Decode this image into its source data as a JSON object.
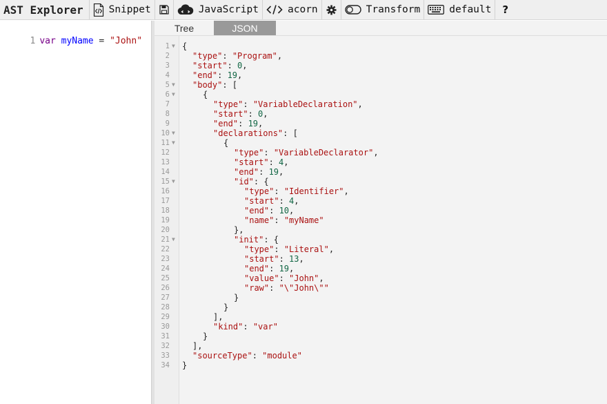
{
  "app": {
    "title": "AST Explorer"
  },
  "toolbar": {
    "snippet_label": "Snippet",
    "language_label": "JavaScript",
    "parser_label": "acorn",
    "transform_label": "Transform",
    "keymap_label": "default",
    "help_label": "?"
  },
  "editor": {
    "line_number": "1",
    "tokens": {
      "keyword": "var",
      "identifier": "myName",
      "operator": "=",
      "string": "\"John\""
    }
  },
  "output": {
    "tabs": [
      {
        "label": "Tree",
        "active": false
      },
      {
        "label": "JSON",
        "active": true
      }
    ],
    "json_lines": [
      {
        "n": "1",
        "fold": true,
        "indent": 0,
        "parts": [
          [
            "p",
            "{"
          ]
        ]
      },
      {
        "n": "2",
        "fold": false,
        "indent": 1,
        "parts": [
          [
            "k",
            "\"type\""
          ],
          [
            "p",
            ": "
          ],
          [
            "s",
            "\"Program\""
          ],
          [
            "p",
            ","
          ]
        ]
      },
      {
        "n": "3",
        "fold": false,
        "indent": 1,
        "parts": [
          [
            "k",
            "\"start\""
          ],
          [
            "p",
            ": "
          ],
          [
            "n",
            "0"
          ],
          [
            "p",
            ","
          ]
        ]
      },
      {
        "n": "4",
        "fold": false,
        "indent": 1,
        "parts": [
          [
            "k",
            "\"end\""
          ],
          [
            "p",
            ": "
          ],
          [
            "n",
            "19"
          ],
          [
            "p",
            ","
          ]
        ]
      },
      {
        "n": "5",
        "fold": true,
        "indent": 1,
        "parts": [
          [
            "k",
            "\"body\""
          ],
          [
            "p",
            ": ["
          ]
        ]
      },
      {
        "n": "6",
        "fold": true,
        "indent": 2,
        "parts": [
          [
            "p",
            "{"
          ]
        ]
      },
      {
        "n": "7",
        "fold": false,
        "indent": 3,
        "parts": [
          [
            "k",
            "\"type\""
          ],
          [
            "p",
            ": "
          ],
          [
            "s",
            "\"VariableDeclaration\""
          ],
          [
            "p",
            ","
          ]
        ]
      },
      {
        "n": "8",
        "fold": false,
        "indent": 3,
        "parts": [
          [
            "k",
            "\"start\""
          ],
          [
            "p",
            ": "
          ],
          [
            "n",
            "0"
          ],
          [
            "p",
            ","
          ]
        ]
      },
      {
        "n": "9",
        "fold": false,
        "indent": 3,
        "parts": [
          [
            "k",
            "\"end\""
          ],
          [
            "p",
            ": "
          ],
          [
            "n",
            "19"
          ],
          [
            "p",
            ","
          ]
        ]
      },
      {
        "n": "10",
        "fold": true,
        "indent": 3,
        "parts": [
          [
            "k",
            "\"declarations\""
          ],
          [
            "p",
            ": ["
          ]
        ]
      },
      {
        "n": "11",
        "fold": true,
        "indent": 4,
        "parts": [
          [
            "p",
            "{"
          ]
        ]
      },
      {
        "n": "12",
        "fold": false,
        "indent": 5,
        "parts": [
          [
            "k",
            "\"type\""
          ],
          [
            "p",
            ": "
          ],
          [
            "s",
            "\"VariableDeclarator\""
          ],
          [
            "p",
            ","
          ]
        ]
      },
      {
        "n": "13",
        "fold": false,
        "indent": 5,
        "parts": [
          [
            "k",
            "\"start\""
          ],
          [
            "p",
            ": "
          ],
          [
            "n",
            "4"
          ],
          [
            "p",
            ","
          ]
        ]
      },
      {
        "n": "14",
        "fold": false,
        "indent": 5,
        "parts": [
          [
            "k",
            "\"end\""
          ],
          [
            "p",
            ": "
          ],
          [
            "n",
            "19"
          ],
          [
            "p",
            ","
          ]
        ]
      },
      {
        "n": "15",
        "fold": true,
        "indent": 5,
        "parts": [
          [
            "k",
            "\"id\""
          ],
          [
            "p",
            ": {"
          ]
        ]
      },
      {
        "n": "16",
        "fold": false,
        "indent": 6,
        "parts": [
          [
            "k",
            "\"type\""
          ],
          [
            "p",
            ": "
          ],
          [
            "s",
            "\"Identifier\""
          ],
          [
            "p",
            ","
          ]
        ]
      },
      {
        "n": "17",
        "fold": false,
        "indent": 6,
        "parts": [
          [
            "k",
            "\"start\""
          ],
          [
            "p",
            ": "
          ],
          [
            "n",
            "4"
          ],
          [
            "p",
            ","
          ]
        ]
      },
      {
        "n": "18",
        "fold": false,
        "indent": 6,
        "parts": [
          [
            "k",
            "\"end\""
          ],
          [
            "p",
            ": "
          ],
          [
            "n",
            "10"
          ],
          [
            "p",
            ","
          ]
        ]
      },
      {
        "n": "19",
        "fold": false,
        "indent": 6,
        "parts": [
          [
            "k",
            "\"name\""
          ],
          [
            "p",
            ": "
          ],
          [
            "s",
            "\"myName\""
          ]
        ]
      },
      {
        "n": "20",
        "fold": false,
        "indent": 5,
        "parts": [
          [
            "p",
            "},"
          ]
        ]
      },
      {
        "n": "21",
        "fold": true,
        "indent": 5,
        "parts": [
          [
            "k",
            "\"init\""
          ],
          [
            "p",
            ": {"
          ]
        ]
      },
      {
        "n": "22",
        "fold": false,
        "indent": 6,
        "parts": [
          [
            "k",
            "\"type\""
          ],
          [
            "p",
            ": "
          ],
          [
            "s",
            "\"Literal\""
          ],
          [
            "p",
            ","
          ]
        ]
      },
      {
        "n": "23",
        "fold": false,
        "indent": 6,
        "parts": [
          [
            "k",
            "\"start\""
          ],
          [
            "p",
            ": "
          ],
          [
            "n",
            "13"
          ],
          [
            "p",
            ","
          ]
        ]
      },
      {
        "n": "24",
        "fold": false,
        "indent": 6,
        "parts": [
          [
            "k",
            "\"end\""
          ],
          [
            "p",
            ": "
          ],
          [
            "n",
            "19"
          ],
          [
            "p",
            ","
          ]
        ]
      },
      {
        "n": "25",
        "fold": false,
        "indent": 6,
        "parts": [
          [
            "k",
            "\"value\""
          ],
          [
            "p",
            ": "
          ],
          [
            "s",
            "\"John\""
          ],
          [
            "p",
            ","
          ]
        ]
      },
      {
        "n": "26",
        "fold": false,
        "indent": 6,
        "parts": [
          [
            "k",
            "\"raw\""
          ],
          [
            "p",
            ": "
          ],
          [
            "s",
            "\"\\\"John\\\"\""
          ]
        ]
      },
      {
        "n": "27",
        "fold": false,
        "indent": 5,
        "parts": [
          [
            "p",
            "}"
          ]
        ]
      },
      {
        "n": "28",
        "fold": false,
        "indent": 4,
        "parts": [
          [
            "p",
            "}"
          ]
        ]
      },
      {
        "n": "29",
        "fold": false,
        "indent": 3,
        "parts": [
          [
            "p",
            "],"
          ]
        ]
      },
      {
        "n": "30",
        "fold": false,
        "indent": 3,
        "parts": [
          [
            "k",
            "\"kind\""
          ],
          [
            "p",
            ": "
          ],
          [
            "s",
            "\"var\""
          ]
        ]
      },
      {
        "n": "31",
        "fold": false,
        "indent": 2,
        "parts": [
          [
            "p",
            "}"
          ]
        ]
      },
      {
        "n": "32",
        "fold": false,
        "indent": 1,
        "parts": [
          [
            "p",
            "],"
          ]
        ]
      },
      {
        "n": "33",
        "fold": false,
        "indent": 1,
        "parts": [
          [
            "k",
            "\"sourceType\""
          ],
          [
            "p",
            ": "
          ],
          [
            "s",
            "\"module\""
          ]
        ]
      },
      {
        "n": "34",
        "fold": false,
        "indent": 0,
        "parts": [
          [
            "p",
            "}"
          ]
        ]
      }
    ]
  },
  "icons": {
    "snippet": "file-code-icon",
    "save": "save-icon",
    "language": "cloud-icon",
    "parser": "code-icon",
    "settings": "gear-icon",
    "transform": "toggle-icon",
    "keymap": "keyboard-icon"
  },
  "colors": {
    "toolbar_bg": "#efefef",
    "active_tab_bg": "#999999",
    "string": "#aa1111",
    "number": "#116644",
    "keyword": "#770088",
    "variable": "#0000ff"
  }
}
